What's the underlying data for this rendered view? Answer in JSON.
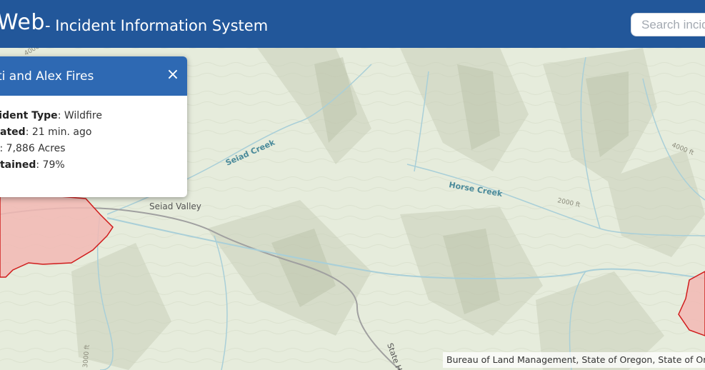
{
  "header": {
    "brand": "Web",
    "subtitle": "- Incident Information System",
    "search_placeholder": "Search incid"
  },
  "popup": {
    "title": "ti and Alex Fires",
    "close_symbol": "×",
    "fields": [
      {
        "label": "cident Type",
        "value": ": Wildfire"
      },
      {
        "label": "dated",
        "value": ": 21 min. ago"
      },
      {
        "label": "e",
        "value": ": 7,886 Acres"
      },
      {
        "label": "ntained",
        "value": ": 79%"
      }
    ]
  },
  "map": {
    "labels": {
      "seiad_creek": "Seiad Creek",
      "horse_creek": "Horse Creek",
      "seiad_valley": "Seiad Valley",
      "state_highway": "State Hw",
      "elev_4000_right": "4000 ft",
      "elev_2000": "2000 ft",
      "elev_4000_top": "4000",
      "elev_3000_bottom": "3000 ft"
    },
    "attribution": "Bureau of Land Management, State of Oregon, State of Orego",
    "colors": {
      "terrain": "#e6ecdc",
      "fire_fill": "#f2b9b4",
      "fire_outline": "#d01c1c",
      "water": "#a9cfd8",
      "road": "#a0a0a0"
    }
  }
}
